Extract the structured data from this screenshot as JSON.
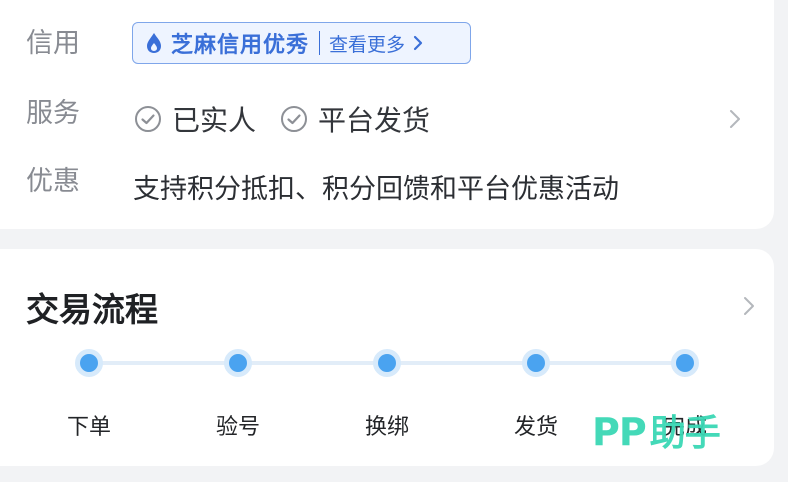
{
  "info": {
    "credit": {
      "label": "信用",
      "badge_text": "芝麻信用优秀",
      "more_label": "查看更多"
    },
    "service": {
      "label": "服务",
      "items": [
        "已实人",
        "平台发货"
      ]
    },
    "promo": {
      "label": "优惠",
      "text": "支持积分抵扣、积分回馈和平台优惠活动"
    }
  },
  "flow": {
    "title": "交易流程",
    "steps": [
      "下单",
      "验号",
      "换绑",
      "发货",
      "完成"
    ]
  },
  "watermark": {
    "latin": "PP",
    "cn": "助手"
  },
  "colors": {
    "accent": "#3a6fd8",
    "step": "#4aa3f0",
    "watermark": "#3bd8b5"
  }
}
